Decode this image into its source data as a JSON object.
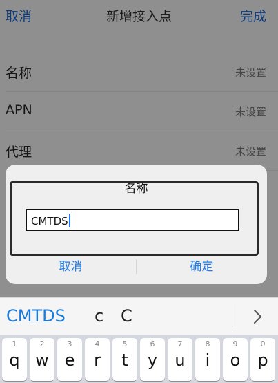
{
  "navbar": {
    "cancel_label": "取消",
    "title": "新增接入点",
    "done_label": "完成"
  },
  "rows": [
    {
      "label": "名称",
      "value": "未设置"
    },
    {
      "label": "APN",
      "value": "未设置"
    },
    {
      "label": "代理",
      "value": "未设置"
    }
  ],
  "dialog": {
    "title": "名称",
    "input_value": "CMTDS",
    "cancel_label": "取消",
    "confirm_label": "确定"
  },
  "suggestions": {
    "primary": "CMTDS",
    "second": "c",
    "third": "C",
    "more_icon": "chevron-right-icon"
  },
  "keyboard": {
    "keys": [
      {
        "num": "1",
        "letter": "q"
      },
      {
        "num": "2",
        "letter": "w"
      },
      {
        "num": "3",
        "letter": "e"
      },
      {
        "num": "4",
        "letter": "r"
      },
      {
        "num": "5",
        "letter": "t"
      },
      {
        "num": "6",
        "letter": "y"
      },
      {
        "num": "7",
        "letter": "u"
      },
      {
        "num": "8",
        "letter": "i"
      },
      {
        "num": "9",
        "letter": "o"
      },
      {
        "num": "0",
        "letter": "p"
      }
    ]
  },
  "colors": {
    "accent": "#1e7ae6",
    "suggestion_primary": "#1c7bd9",
    "dim_background": "#8f8f8f"
  }
}
